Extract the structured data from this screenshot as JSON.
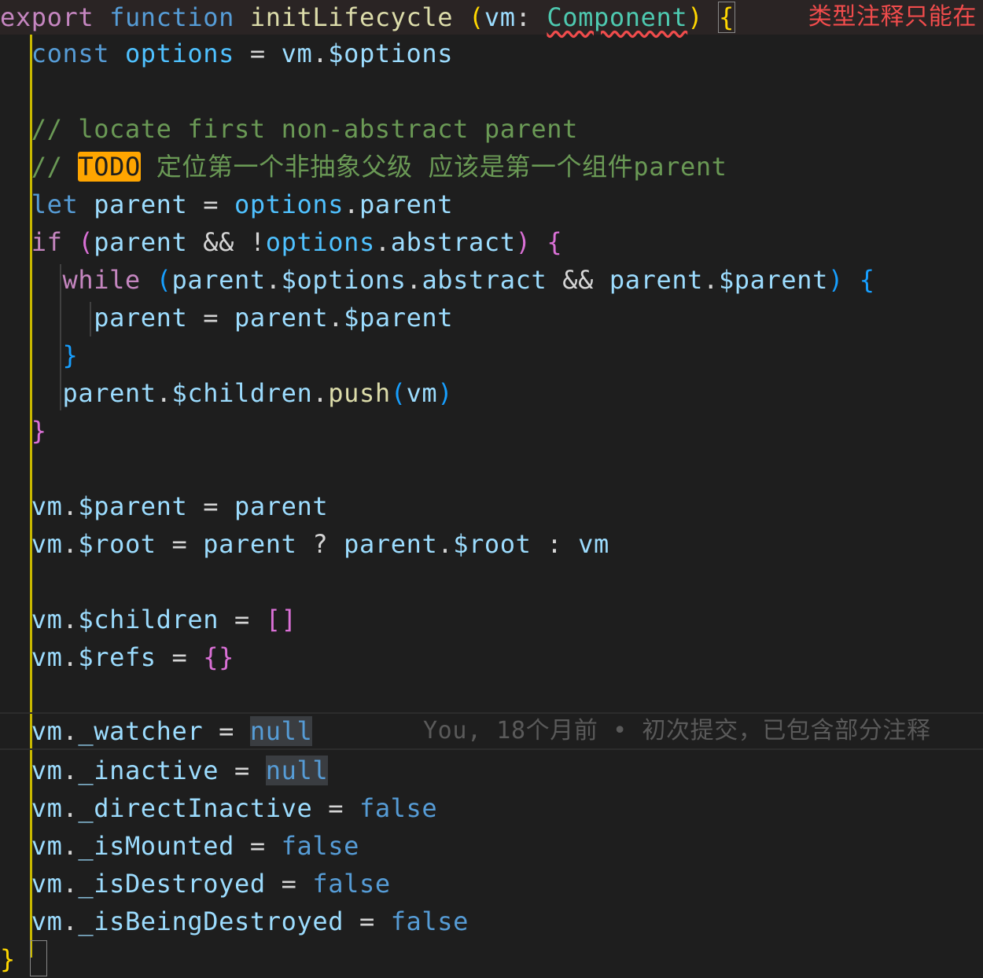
{
  "error_lens": "类型注释只能在",
  "blame": "You, 18个月前 • 初次提交，已包含部分注释",
  "code": {
    "l1": [
      "export",
      "function",
      "initLifecycle",
      "(",
      "vm",
      ":",
      "Component",
      ")",
      "{"
    ],
    "l2": [
      "const",
      "options",
      "=",
      "vm",
      ".",
      "$options"
    ],
    "l4": [
      "// locate first non-abstract parent"
    ],
    "l5": [
      "//",
      "TODO",
      "定位第一个非抽象父级 应该是第一个组件parent"
    ],
    "l6": [
      "let",
      "parent",
      "=",
      "options",
      ".",
      "parent"
    ],
    "l7": [
      "if",
      "(",
      "parent",
      "&&",
      "!",
      "options",
      ".",
      "abstract",
      ")",
      "{"
    ],
    "l8": [
      "while",
      "(",
      "parent",
      ".",
      "$options",
      ".",
      "abstract",
      "&&",
      "parent",
      ".",
      "$parent",
      ")",
      "{"
    ],
    "l9": [
      "parent",
      "=",
      "parent",
      ".",
      "$parent"
    ],
    "l10": [
      "}"
    ],
    "l11": [
      "parent",
      ".",
      "$children",
      ".",
      "push",
      "(",
      "vm",
      ")"
    ],
    "l12": [
      "}"
    ],
    "l14": [
      "vm",
      ".",
      "$parent",
      "=",
      "parent"
    ],
    "l15": [
      "vm",
      ".",
      "$root",
      "=",
      "parent",
      "?",
      "parent",
      ".",
      "$root",
      ":",
      "vm"
    ],
    "l17": [
      "vm",
      ".",
      "$children",
      "=",
      "[",
      "]"
    ],
    "l18": [
      "vm",
      ".",
      "$refs",
      "=",
      "{",
      "}"
    ],
    "l20": [
      "vm",
      ".",
      "_watcher",
      "=",
      "null"
    ],
    "l21": [
      "vm",
      ".",
      "_inactive",
      "=",
      "null"
    ],
    "l22": [
      "vm",
      ".",
      "_directInactive",
      "=",
      "false"
    ],
    "l23": [
      "vm",
      ".",
      "_isMounted",
      "=",
      "false"
    ],
    "l24": [
      "vm",
      ".",
      "_isDestroyed",
      "=",
      "false"
    ],
    "l25": [
      "vm",
      ".",
      "_isBeingDestroyed",
      "=",
      "false"
    ],
    "l26": [
      "}"
    ]
  }
}
